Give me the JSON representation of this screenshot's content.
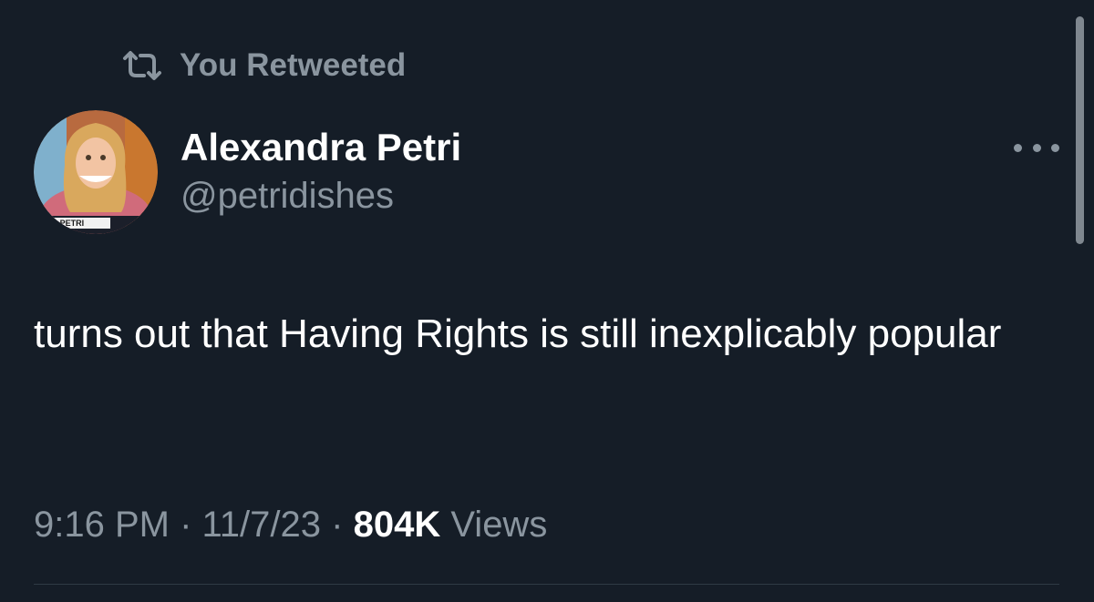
{
  "retweet_context": {
    "label": "You Retweeted",
    "icon": "retweet-icon"
  },
  "author": {
    "name": "Alexandra Petri",
    "handle": "@petridishes",
    "avatar_caption": "A PETRI"
  },
  "more_menu": {
    "icon": "more-horizontal-icon"
  },
  "tweet": {
    "text": "turns out that Having Rights is still inexplicably popular"
  },
  "meta": {
    "time": "9:16 PM",
    "separator": "·",
    "date": "11/7/23",
    "views_count": "804K",
    "views_label": "Views"
  },
  "colors": {
    "background": "#151d27",
    "primary_text": "#ffffff",
    "secondary_text": "#8a959f",
    "divider": "#2f3a45"
  }
}
